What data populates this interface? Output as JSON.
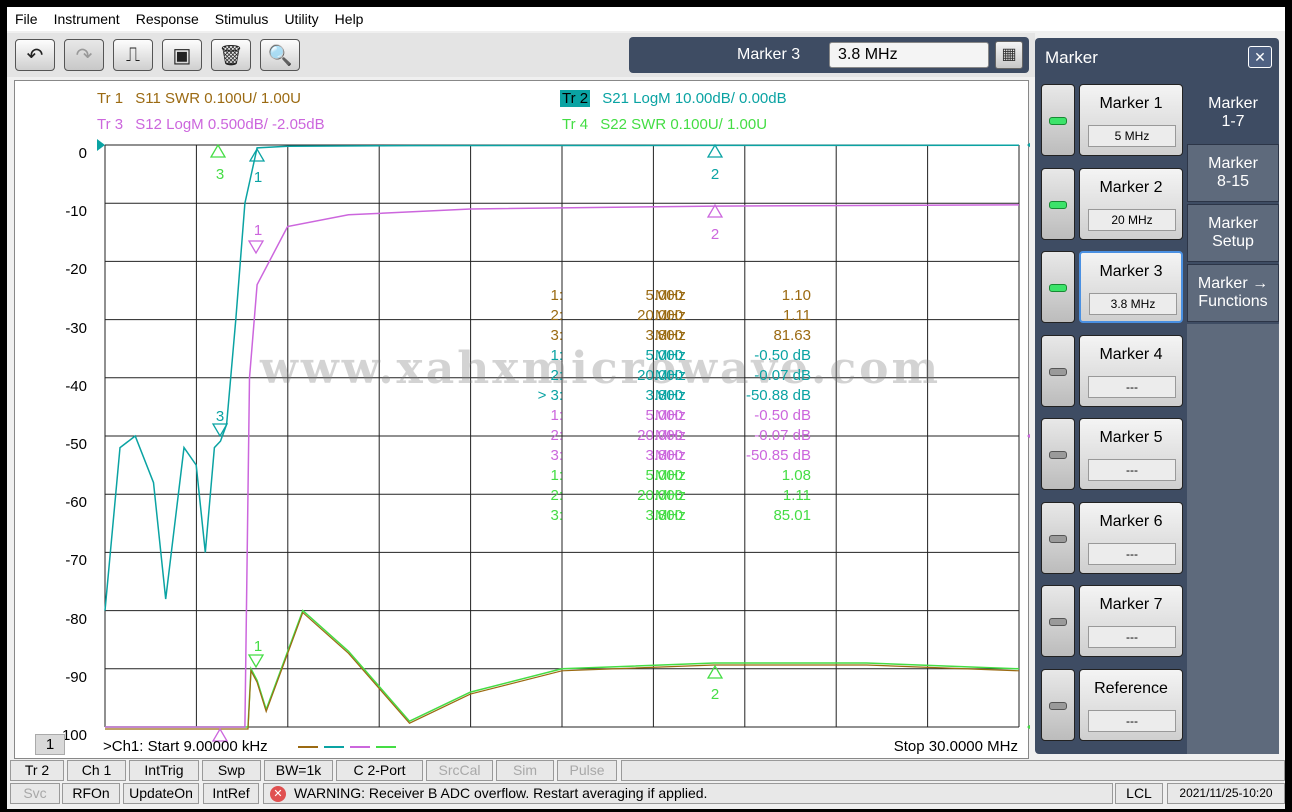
{
  "menu": [
    "File",
    "Instrument",
    "Response",
    "Stimulus",
    "Utility",
    "Help"
  ],
  "toolbar": {
    "buttons": [
      {
        "name": "undo-icon",
        "glyph": "↶"
      },
      {
        "name": "redo-icon",
        "glyph": "↷"
      },
      {
        "name": "add-marker-icon",
        "glyph": "⎍"
      },
      {
        "name": "cal-icon",
        "glyph": "▣"
      },
      {
        "name": "trash-icon",
        "glyph": "🗑"
      },
      {
        "name": "zoom-icon",
        "glyph": "🔍"
      }
    ],
    "marker_entry_label": "Marker 3",
    "marker_entry_value": "3.8 MHz",
    "keypad_glyph": "▦"
  },
  "traces": [
    {
      "label": "Tr  1",
      "desc": "S11 SWR 0.100U/  1.00U",
      "color": "#9b6a12"
    },
    {
      "label": "Tr  2",
      "desc": "S21 LogM 10.00dB/  0.00dB",
      "color": "#0aa3a3"
    },
    {
      "label": "Tr  3",
      "desc": "S12 LogM 0.500dB/  -2.05dB",
      "color": "#cc66dd"
    },
    {
      "label": "Tr  4",
      "desc": "S22 SWR 0.100U/  1.00U",
      "color": "#44dd44"
    }
  ],
  "y_ticks": [
    "0",
    "-10",
    "-20",
    "-30",
    "-40",
    "-50",
    "-60",
    "-70",
    "-80",
    "-90",
    "-100"
  ],
  "marker_table": [
    {
      "idx": "1:",
      "freq": "5.000",
      "unit": "MHz",
      "val": "1.10",
      "color": "#9b6a12"
    },
    {
      "idx": "2:",
      "freq": "20.000",
      "unit": "MHz",
      "val": "1.11",
      "color": "#9b6a12"
    },
    {
      "idx": "3:",
      "freq": "3.800",
      "unit": "MHz",
      "val": "81.63",
      "color": "#9b6a12"
    },
    {
      "idx": "1:",
      "freq": "5.000",
      "unit": "MHz",
      "val": "-0.50 dB",
      "color": "#0aa3a3"
    },
    {
      "idx": "2:",
      "freq": "20.000",
      "unit": "MHz",
      "val": "-0.07 dB",
      "color": "#0aa3a3"
    },
    {
      "idx": "> 3:",
      "freq": "3.800",
      "unit": "MHz",
      "val": "-50.88 dB",
      "color": "#0aa3a3"
    },
    {
      "idx": "1:",
      "freq": "5.000",
      "unit": "MHz",
      "val": "-0.50 dB",
      "color": "#cc66dd"
    },
    {
      "idx": "2:",
      "freq": "20.000",
      "unit": "MHz",
      "val": "-0.07 dB",
      "color": "#cc66dd"
    },
    {
      "idx": "3:",
      "freq": "3.800",
      "unit": "MHz",
      "val": "-50.85 dB",
      "color": "#cc66dd"
    },
    {
      "idx": "1:",
      "freq": "5.000",
      "unit": "MHz",
      "val": "1.08",
      "color": "#44dd44"
    },
    {
      "idx": "2:",
      "freq": "20.000",
      "unit": "MHz",
      "val": "1.11",
      "color": "#44dd44"
    },
    {
      "idx": "3:",
      "freq": "3.800",
      "unit": "MHz",
      "val": "85.01",
      "color": "#44dd44"
    }
  ],
  "watermark": "www.xahxmicrowave.com",
  "footer": {
    "channel_badge": "1",
    "start": ">Ch1:  Start  9.00000 kHz",
    "stop": "Stop  30.0000 MHz"
  },
  "marker_labels": {
    "m1": "1",
    "m2": "2",
    "m3": "3"
  },
  "panel": {
    "title": "Marker",
    "close": "✕",
    "markers": [
      {
        "label": "Marker 1",
        "value": "5 MHz",
        "led_on": true
      },
      {
        "label": "Marker 2",
        "value": "20 MHz",
        "led_on": true
      },
      {
        "label": "Marker 3",
        "value": "3.8 MHz",
        "led_on": true
      },
      {
        "label": "Marker 4",
        "value": "---",
        "led_on": false
      },
      {
        "label": "Marker 5",
        "value": "---",
        "led_on": false
      },
      {
        "label": "Marker 6",
        "value": "---",
        "led_on": false
      },
      {
        "label": "Marker 7",
        "value": "---",
        "led_on": false
      },
      {
        "label": "Reference",
        "value": "---",
        "led_on": false
      }
    ],
    "tabs": [
      {
        "label": "Marker\n1-7"
      },
      {
        "label": "Marker\n8-15"
      },
      {
        "label": "Marker\nSetup"
      },
      {
        "label": "Marker →\nFunctions"
      }
    ]
  },
  "status_row1": [
    "Tr 2",
    "Ch 1",
    "IntTrig",
    "Swp",
    "BW=1k",
    "C  2-Port",
    "SrcCal",
    "Sim",
    "Pulse"
  ],
  "status_row2": [
    "Svc",
    "RFOn",
    "UpdateOn",
    "IntRef"
  ],
  "warning": "WARNING: Receiver B ADC overflow. Restart averaging if applied.",
  "lcl": "LCL",
  "datetime": "2021/11/25-10:20",
  "chart_data": {
    "type": "line",
    "x_range_mhz": [
      0.009,
      30
    ],
    "ylim": [
      -100,
      0
    ],
    "grid": true,
    "note_axis": "LogM dB for Tr 2",
    "series": [
      {
        "name": "Tr 2 S21",
        "x": [
          0.009,
          0.5,
          1.0,
          1.6,
          2.0,
          2.6,
          3.0,
          3.3,
          3.6,
          3.8,
          4.0,
          4.3,
          4.6,
          5.0,
          6,
          10,
          20,
          30
        ],
        "y": [
          -80,
          -52,
          -50,
          -58,
          -78,
          -52,
          -55,
          -70,
          -52,
          -50.88,
          -48,
          -30,
          -10,
          -0.5,
          -0.2,
          -0.1,
          -0.07,
          -0.05
        ]
      },
      {
        "name": "Tr 4 S22",
        "x": [
          0.009,
          4.7,
          4.8,
          5.0,
          5.3,
          6.5,
          8,
          10,
          12,
          15,
          20,
          25,
          30
        ],
        "y": [
          -100,
          -100,
          -90,
          -92,
          -97,
          -80,
          -87,
          -99,
          -94,
          -90,
          -89,
          -89,
          -90
        ]
      }
    ]
  }
}
